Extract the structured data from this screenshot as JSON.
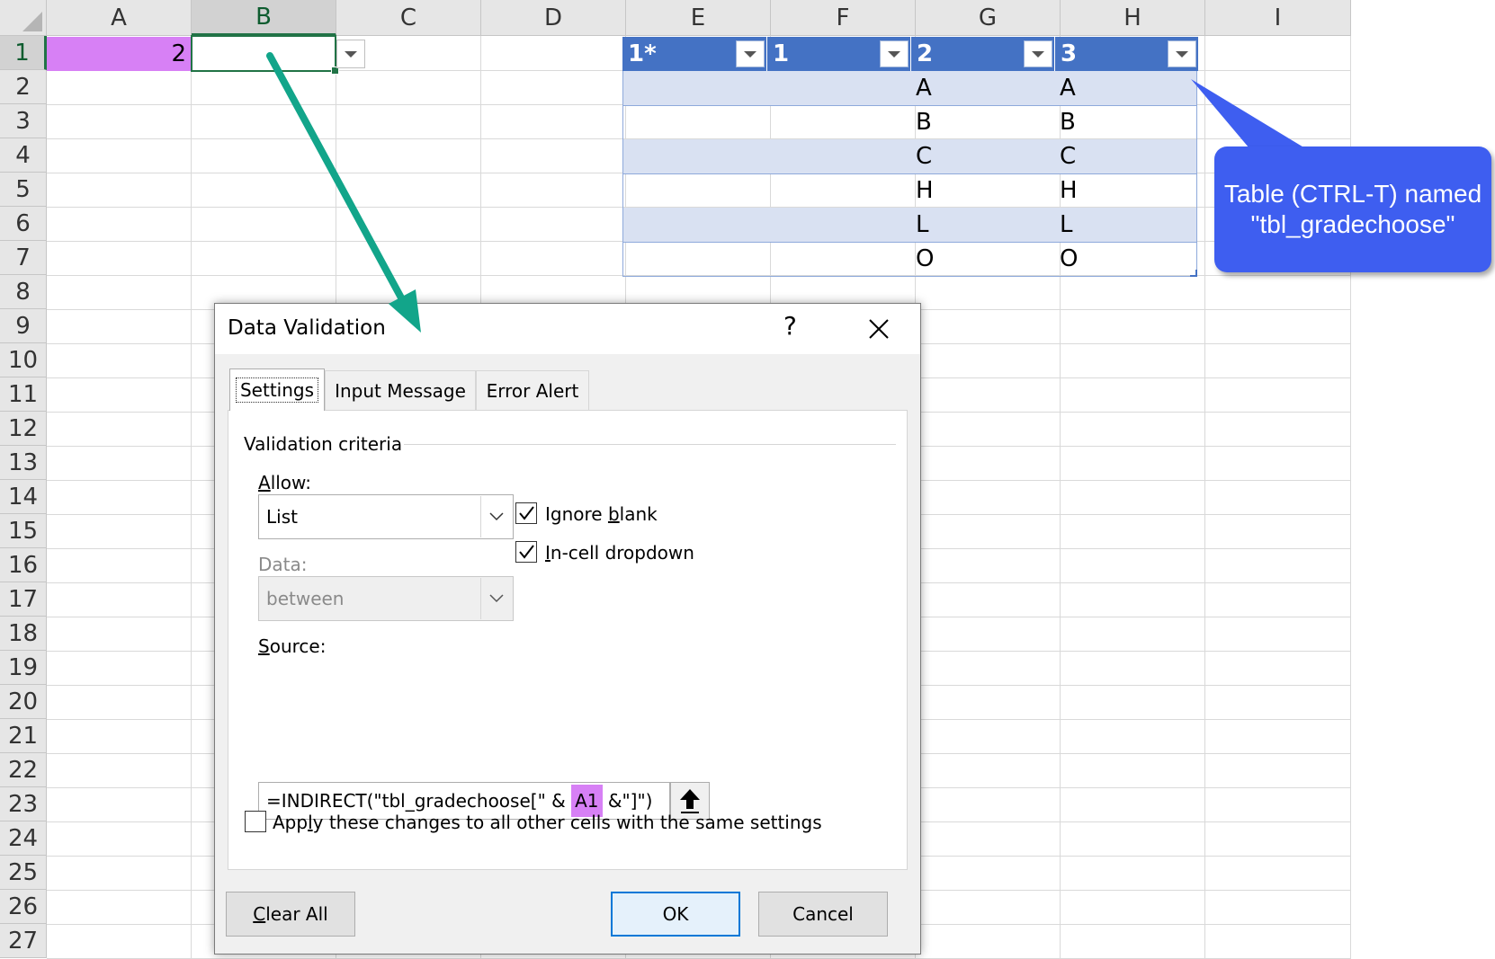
{
  "sheet": {
    "columns": [
      "A",
      "B",
      "C",
      "D",
      "E",
      "F",
      "G",
      "H",
      "I"
    ],
    "rows": [
      "1",
      "2",
      "3",
      "4",
      "5",
      "6",
      "7",
      "8",
      "9",
      "10",
      "11",
      "12",
      "13",
      "14",
      "15",
      "16",
      "17",
      "18",
      "19",
      "20",
      "21",
      "22",
      "23",
      "24",
      "25",
      "26",
      "27"
    ],
    "selected_column": "B",
    "selected_row": "1",
    "a1_value": "2"
  },
  "table": {
    "headers": [
      "1*",
      "1",
      "2",
      "3"
    ],
    "col_g": [
      "A",
      "B",
      "C",
      "H",
      "L",
      "O"
    ],
    "col_h": [
      "A",
      "B",
      "C",
      "H",
      "L",
      "O"
    ]
  },
  "callout": {
    "line1": "Table (CTRL-T) named",
    "line2": "\"tbl_gradechoose\"",
    "color": "#3e5ef0"
  },
  "dialog": {
    "title": "Data Validation",
    "help": "?",
    "tabs": [
      "Settings",
      "Input Message",
      "Error Alert"
    ],
    "active_tab": "Settings",
    "group_label": "Validation criteria",
    "allow": {
      "a": "A",
      "rest": "llow:",
      "value": "List"
    },
    "data": {
      "label": "Data:",
      "value": "between"
    },
    "ignore_blank": {
      "pre": "Ignore ",
      "u": "b",
      "post": "lank",
      "checked": true
    },
    "in_cell": {
      "u": "I",
      "post": "n-cell dropdown",
      "checked": true
    },
    "source": {
      "u": "S",
      "rest": "ource:",
      "formula_pre": "=INDIRECT(\"tbl_gradechoose[\" & ",
      "formula_ref": "A1",
      "formula_post": " &\"]\")"
    },
    "apply": {
      "pre": "App",
      "u": "l",
      "post": "y these changes to all other cells with the same settings",
      "checked": false
    },
    "buttons": {
      "clear_u": "C",
      "clear_rest": "lear All",
      "ok": "OK",
      "cancel": "Cancel"
    }
  },
  "colors": {
    "highlight": "#d780f5",
    "table_header": "#4472c4",
    "table_band": "#d9e1f2",
    "arrow": "#12a58a"
  }
}
